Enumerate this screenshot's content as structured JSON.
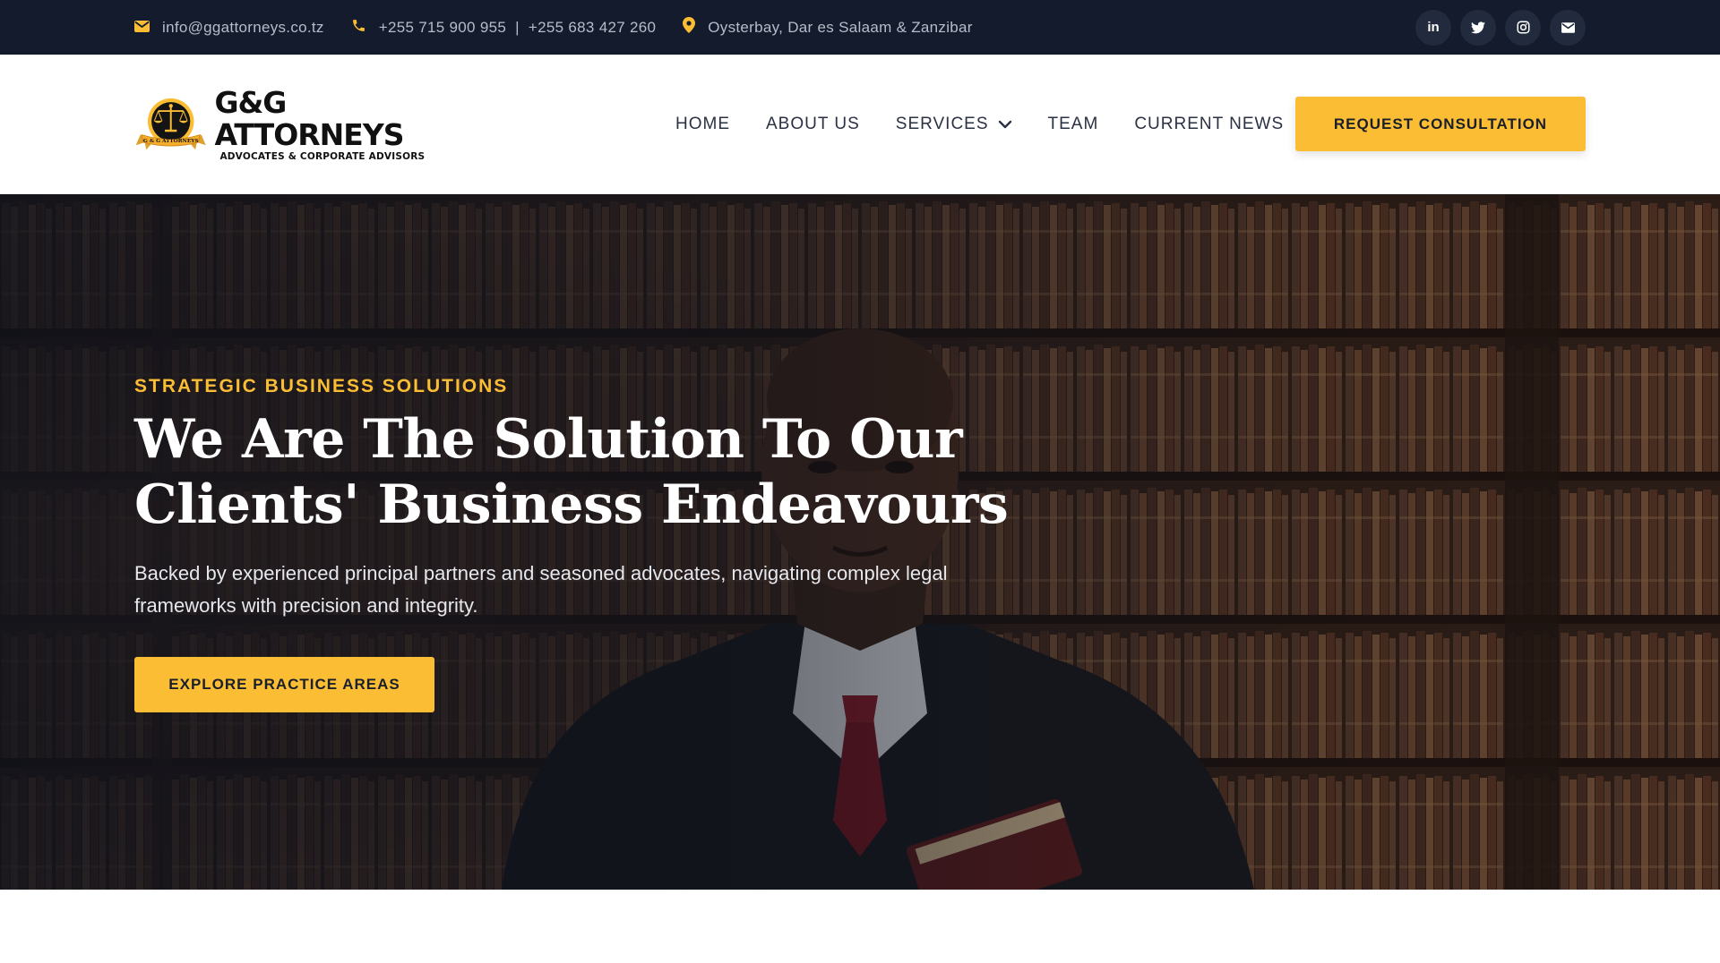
{
  "colors": {
    "topbar_bg": "#141b2d",
    "accent": "#fbbd33",
    "nav_text": "#2a3142",
    "hero_text": "#ffffff"
  },
  "topbar": {
    "email": {
      "icon": "envelope-icon",
      "text": "info@ggattorneys.co.tz"
    },
    "phone": {
      "icon": "phone-icon",
      "text": "+255 715 900 955  |  +255 683 427 260"
    },
    "location": {
      "icon": "map-pin-icon",
      "text": "Oysterbay, Dar es Salaam & Zanzibar"
    },
    "socials": [
      {
        "icon": "linkedin-icon",
        "label": "in"
      },
      {
        "icon": "twitter-icon"
      },
      {
        "icon": "instagram-icon"
      },
      {
        "icon": "envelope-icon"
      }
    ]
  },
  "header": {
    "logo": {
      "title": "G&G ATTORNEYS",
      "subtitle": "ADVOCATES & CORPORATE ADVISORS",
      "badge_text": "G & G ATTORNEYS"
    },
    "nav": [
      {
        "label": "HOME"
      },
      {
        "label": "ABOUT US"
      },
      {
        "label": "SERVICES",
        "icon": "chevron-down-icon"
      },
      {
        "label": "TEAM"
      },
      {
        "label": "CURRENT NEWS"
      }
    ],
    "cta_label": "REQUEST CONSULTATION"
  },
  "hero": {
    "eyebrow": "STRATEGIC BUSINESS SOLUTIONS",
    "headline": "We Are The Solution To Our Clients' Business Endeavours",
    "subtext": "Backed by experienced principal partners and seasoned advocates, navigating complex legal frameworks with precision and integrity.",
    "button_label": "EXPLORE PRACTICE AREAS"
  }
}
